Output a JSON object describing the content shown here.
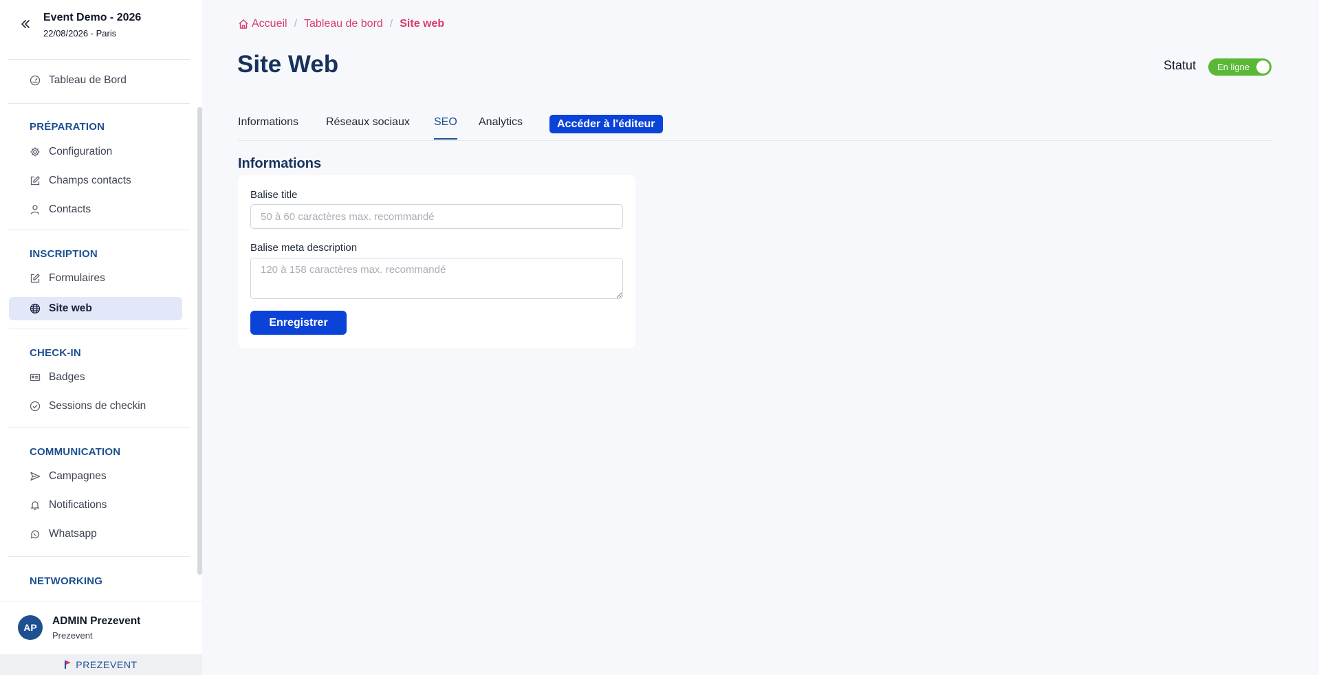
{
  "event": {
    "title": "Event Demo - 2026",
    "subtitle": "22/08/2026 - Paris"
  },
  "sidebar": {
    "dashboard": "Tableau de Bord",
    "sections": {
      "preparation": "PRÉPARATION",
      "inscription": "INSCRIPTION",
      "checkin": "CHECK-IN",
      "communication": "COMMUNICATION",
      "networking": "NETWORKING"
    },
    "items": {
      "configuration": "Configuration",
      "champs_contacts": "Champs contacts",
      "contacts": "Contacts",
      "formulaires": "Formulaires",
      "site_web": "Site web",
      "badges": "Badges",
      "sessions_checkin": "Sessions de checkin",
      "campagnes": "Campagnes",
      "notifications": "Notifications",
      "whatsapp": "Whatsapp"
    },
    "active_item": "site_web"
  },
  "user": {
    "initials": "AP",
    "name": "ADMIN Prezevent",
    "org": "Prezevent"
  },
  "brand": {
    "name": "PREZEVENT"
  },
  "breadcrumb": {
    "home": "Accueil",
    "dashboard": "Tableau de bord",
    "current": "Site web"
  },
  "page": {
    "title": "Site Web"
  },
  "status": {
    "label": "Statut",
    "toggle_text": "En ligne",
    "is_online": true
  },
  "tabs": {
    "informations": "Informations",
    "reseaux": "Réseaux sociaux",
    "seo": "SEO",
    "analytics": "Analytics",
    "editor_button": "Accéder à l'éditeur",
    "active": "seo"
  },
  "form": {
    "heading": "Informations",
    "title_label": "Balise title",
    "title_value": "",
    "title_placeholder": "50 à 60 caractères max. recommandé",
    "meta_label": "Balise meta description",
    "meta_value": "",
    "meta_placeholder": "120 à 158 caractères max. recommandé",
    "save_label": "Enregistrer"
  },
  "colors": {
    "primary": "#0b43d9",
    "navy": "#17325c",
    "section": "#1d4f91",
    "breadcrumb": "#d83a6b",
    "status_green": "#5bb837",
    "active_bg": "#e2e8f7"
  }
}
